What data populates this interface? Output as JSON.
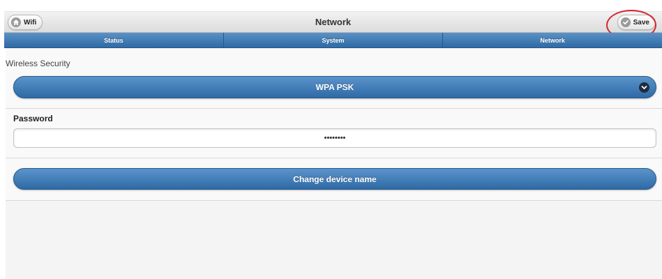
{
  "header": {
    "title": "Network",
    "back_label": "Wifi",
    "save_label": "Save"
  },
  "navbar": {
    "tabs": [
      {
        "label": "Status"
      },
      {
        "label": "System"
      },
      {
        "label": "Network"
      }
    ]
  },
  "security": {
    "label": "Wireless Security",
    "selected": "WPA PSK"
  },
  "password": {
    "label": "Password",
    "value": "••••••••"
  },
  "actions": {
    "change_name_label": "Change device name"
  },
  "colors": {
    "accent": "#3a78b5",
    "highlight_ring": "#d7252b"
  }
}
